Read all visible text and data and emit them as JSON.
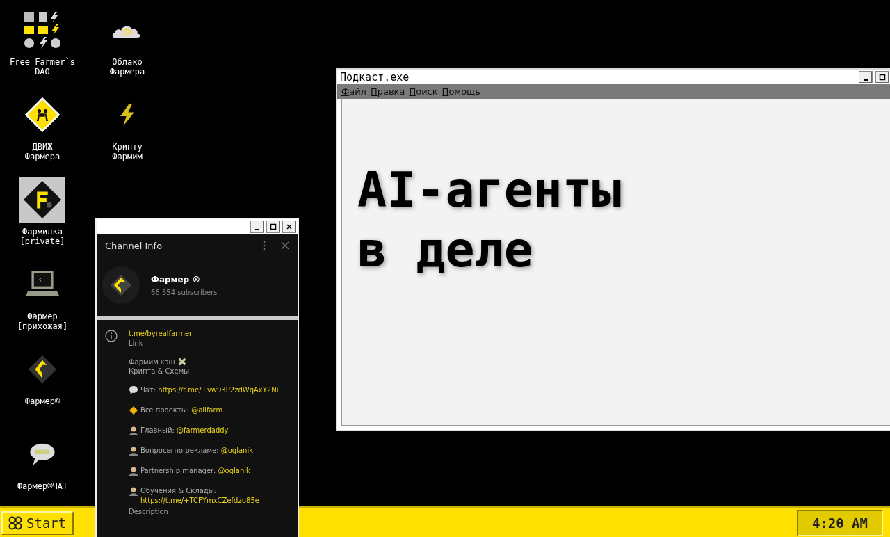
{
  "desktop": {
    "columns": [
      [
        {
          "label": "Free Farmer`s\nDAO",
          "kind": "dao",
          "selected": false
        },
        {
          "label": "ДВИЖ\nФармера",
          "kind": "sign",
          "selected": false
        },
        {
          "label": "Фармилка\n[private]",
          "kind": "chip",
          "selected": true
        },
        {
          "label": "Фармер\n[прихожая]",
          "kind": "computer",
          "selected": false
        },
        {
          "label": "Фармер®",
          "kind": "logo",
          "selected": false
        },
        {
          "label": "Фармер®ЧАТ",
          "kind": "chat",
          "selected": false
        }
      ],
      [
        {
          "label": "Облако\nФармера",
          "kind": "cloud",
          "selected": false
        },
        {
          "label": "Крипту\nФармим",
          "kind": "bolt",
          "selected": false
        }
      ]
    ]
  },
  "channel_window": {
    "header": "Channel Info",
    "name": "Фармер ®",
    "subscribers": "66 554 subscribers",
    "link": "t.me/byrealfarmer",
    "link_caption": "Link",
    "about": [
      "Фармим кэш",
      "Крипта & Схемы"
    ],
    "contacts": [
      {
        "kind": "chat",
        "label": "Чат:",
        "value": "https://t.me/+vw93P2zdWqAxY2Ni"
      },
      {
        "kind": "sign",
        "label": "Все проекты:",
        "value": "@allfarm"
      },
      {
        "kind": "person",
        "label": "Главный:",
        "value": "@farmerdaddy"
      },
      {
        "kind": "person",
        "label": "Вопросы по рекламе:",
        "value": "@oglanik"
      },
      {
        "kind": "person",
        "label": "Partnership manager:",
        "value": "@oglanik"
      },
      {
        "kind": "person",
        "label": "Обучения & Склады:",
        "value": "https://t.me/+TCFYmxCZefdzu85e"
      }
    ],
    "description_caption": "Description"
  },
  "podcast_window": {
    "title": "Подкаст.exe",
    "menu": [
      "Файл",
      "Правка",
      "Поиск",
      "Помощь"
    ],
    "lines": [
      "AI-агенты",
      "в деле"
    ]
  },
  "taskbar": {
    "start": "Start",
    "clock": "4:20 AM"
  }
}
